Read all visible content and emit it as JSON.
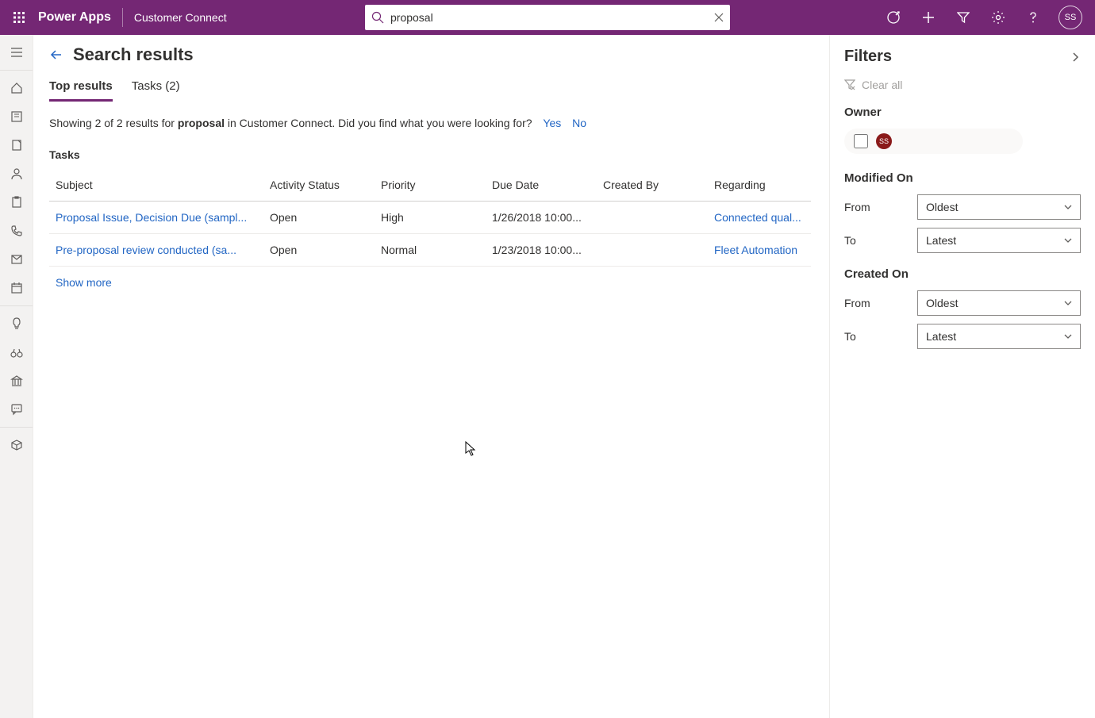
{
  "header": {
    "app_name": "Power Apps",
    "environment": "Customer Connect",
    "search_value": "proposal",
    "avatar_initials": "SS"
  },
  "page": {
    "title": "Search results",
    "tabs": [
      {
        "label": "Top results",
        "active": true
      },
      {
        "label": "Tasks (2)",
        "active": false
      }
    ],
    "summary_prefix": "Showing 2 of 2 results for ",
    "summary_term": "proposal",
    "summary_suffix": " in Customer Connect. Did you find what you were looking for?",
    "yes": "Yes",
    "no": "No",
    "section_label": "Tasks",
    "columns": {
      "subject": "Subject",
      "activity_status": "Activity Status",
      "priority": "Priority",
      "due_date": "Due Date",
      "created_by": "Created By",
      "regarding": "Regarding"
    },
    "rows": [
      {
        "subject": "Proposal Issue, Decision Due (sampl...",
        "activity_status": "Open",
        "priority": "High",
        "due_date": "1/26/2018 10:00...",
        "created_by": "",
        "regarding": "Connected qual..."
      },
      {
        "subject": "Pre-proposal review conducted (sa...",
        "activity_status": "Open",
        "priority": "Normal",
        "due_date": "1/23/2018 10:00...",
        "created_by": "",
        "regarding": "Fleet Automation"
      }
    ],
    "show_more": "Show more"
  },
  "filters": {
    "title": "Filters",
    "clear_all": "Clear all",
    "owner_label": "Owner",
    "owner_initials": "SS",
    "modified_on_label": "Modified On",
    "created_on_label": "Created On",
    "from_label": "From",
    "to_label": "To",
    "oldest": "Oldest",
    "latest": "Latest"
  }
}
